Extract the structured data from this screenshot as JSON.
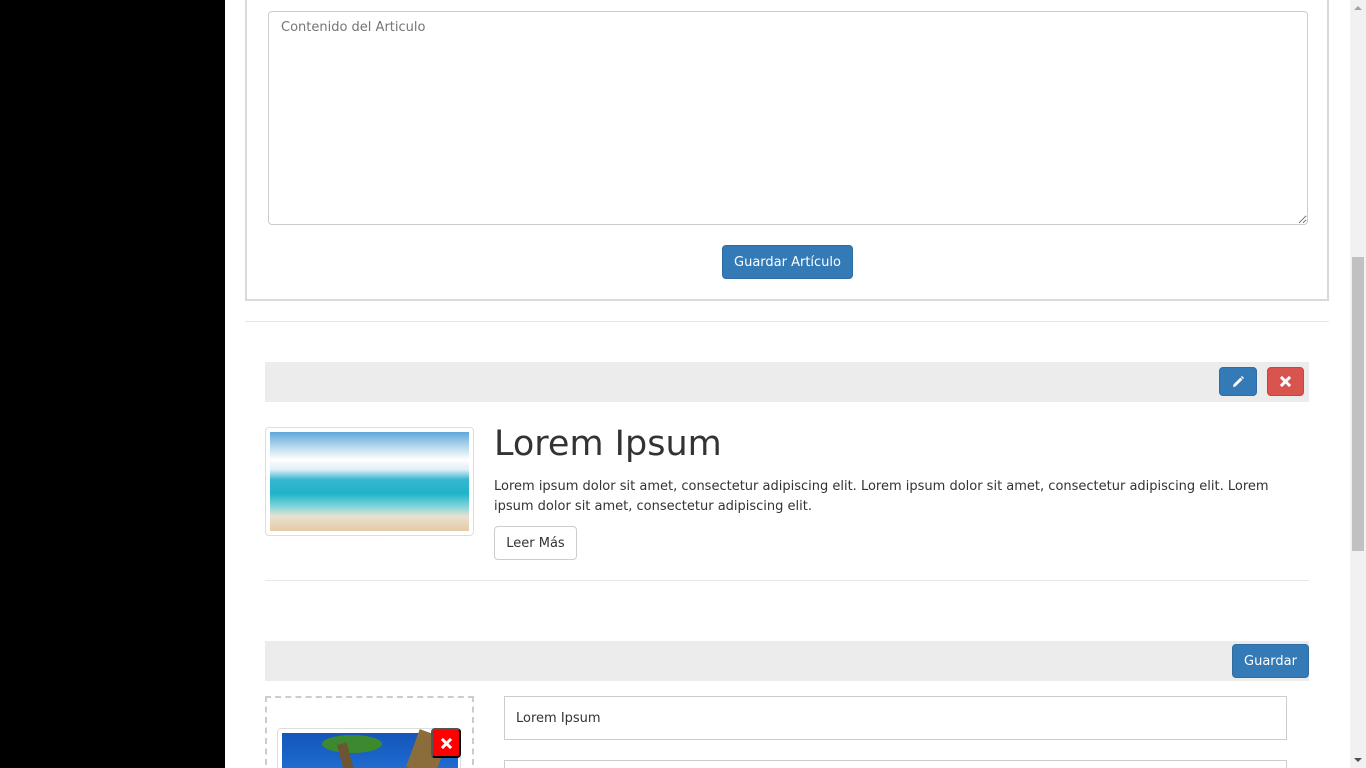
{
  "form": {
    "content_placeholder": "Contenido del Articulo",
    "save_article_label": "Guardar Artículo"
  },
  "article": {
    "title": "Lorem Ipsum",
    "body": "Lorem ipsum dolor sit amet, consectetur adipiscing elit. Lorem ipsum dolor sit amet, consectetur adipiscing elit. Lorem ipsum dolor sit amet, consectetur adipiscing elit.",
    "read_more_label": "Leer Más",
    "edit_icon": "pencil-icon",
    "delete_icon": "times-icon"
  },
  "edit_article": {
    "save_label": "Guardar",
    "title_value": "Lorem Ipsum",
    "remove_image_icon": "times-icon"
  },
  "colors": {
    "primary": "#337ab7",
    "danger": "#d9534f",
    "remove_red": "#ff0000",
    "toolbar_bg": "#ececec"
  }
}
